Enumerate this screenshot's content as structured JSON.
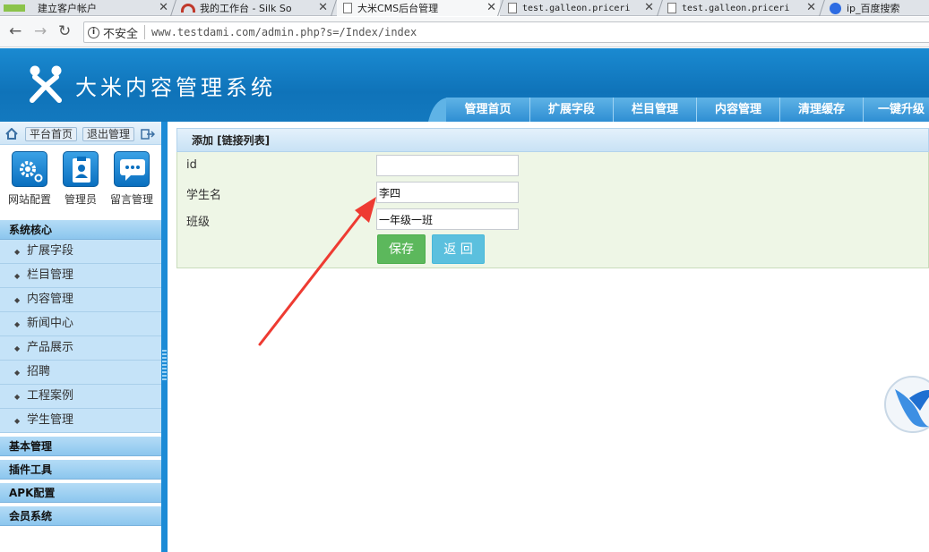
{
  "browser": {
    "tabs": [
      {
        "title": "建立客户帐户"
      },
      {
        "title": "我的工作台 - Silk So"
      },
      {
        "title": "大米CMS后台管理"
      },
      {
        "title": "test.galleon.priceri"
      },
      {
        "title": "test.galleon.priceri"
      },
      {
        "title": "ip_百度搜索"
      }
    ],
    "security_label": "不安全",
    "url": "www.testdami.com/admin.php?s=/Index/index"
  },
  "app": {
    "title": "大米内容管理系统",
    "top_nav": [
      "管理首页",
      "扩展字段",
      "栏目管理",
      "内容管理",
      "清理缓存",
      "一键升级"
    ]
  },
  "sidebar": {
    "platform_home": "平台首页",
    "logout": "退出管理",
    "quick": [
      {
        "label": "网站配置",
        "icon": "gear-icon"
      },
      {
        "label": "管理员",
        "icon": "admin-icon"
      },
      {
        "label": "留言管理",
        "icon": "message-icon"
      }
    ],
    "section_core": "系统核心",
    "core_items": [
      "扩展字段",
      "栏目管理",
      "内容管理",
      "新闻中心",
      "产品展示",
      "招聘",
      "工程案例",
      "学生管理"
    ],
    "sections": [
      "基本管理",
      "插件工具",
      "APK配置",
      "会员系统"
    ]
  },
  "form": {
    "heading": "添加 [链接列表]",
    "fields": [
      {
        "label": "id",
        "value": ""
      },
      {
        "label": "学生名",
        "value": "李四"
      },
      {
        "label": "班级",
        "value": "一年级一班"
      }
    ],
    "save_label": "保存",
    "back_label": "返 回"
  },
  "colors": {
    "header": "#0f73b9",
    "save_button": "#5cb85c",
    "back_button": "#5bc0de",
    "annotation_arrow": "#ee3b32"
  }
}
